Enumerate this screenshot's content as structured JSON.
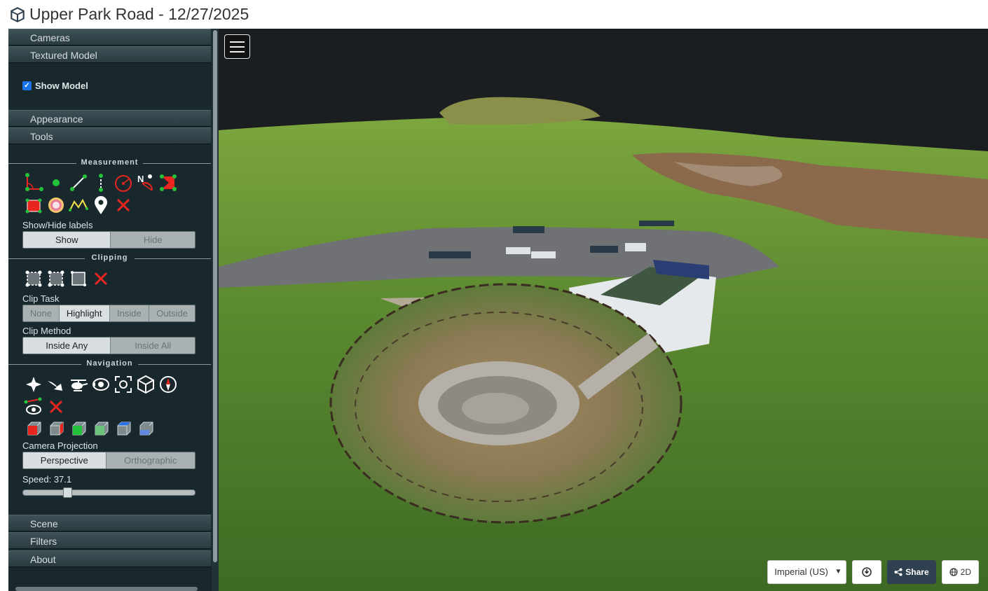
{
  "title": "Upper Park Road - 12/27/2025",
  "title_icon": "cube-icon",
  "sidebar": {
    "headers": {
      "cameras": "Cameras",
      "textured_model": "Textured Model",
      "appearance": "Appearance",
      "tools": "Tools",
      "scene": "Scene",
      "filters": "Filters",
      "about": "About"
    },
    "textured_model": {
      "show_model_label": "Show Model",
      "show_model_checked": true
    },
    "measurement": {
      "title": "Measurement",
      "tools": [
        "angle-icon",
        "point-icon",
        "distance-icon",
        "height-icon",
        "circle-icon",
        "azimuth-icon",
        "area-icon",
        "volume-icon",
        "profile-color-icon",
        "profile-line-icon",
        "annotation-icon",
        "remove-all-icon"
      ],
      "labels_title": "Show/Hide labels",
      "labels_options": [
        "Show",
        "Hide"
      ],
      "labels_selected": "Show"
    },
    "clipping": {
      "title": "Clipping",
      "tools": [
        "clip-volume-icon",
        "clip-polygon-icon",
        "clip-screen-box-icon",
        "remove-clip-icon"
      ],
      "task_title": "Clip Task",
      "task_options": [
        "None",
        "Highlight",
        "Inside",
        "Outside"
      ],
      "task_selected": "Highlight",
      "method_title": "Clip Method",
      "method_options": [
        "Inside Any",
        "Inside All"
      ],
      "method_selected": "Inside Any"
    },
    "navigation": {
      "title": "Navigation",
      "tools": [
        "earth-control-icon",
        "fly-control-icon",
        "helicopter-control-icon",
        "orbit-control-icon",
        "focus-icon",
        "navigation-cube-icon",
        "compass-icon",
        "camera-animation-icon",
        "remove-camera-icon"
      ],
      "views": [
        "left-view-icon",
        "front-view-icon",
        "top-view-icon",
        "bottom-view-icon",
        "right-view-icon",
        "back-view-icon"
      ],
      "projection_title": "Camera Projection",
      "projection_options": [
        "Perspective",
        "Orthographic"
      ],
      "projection_selected": "Perspective",
      "speed_label": "Speed: 37.1",
      "speed_fraction": 0.25
    }
  },
  "viewer": {
    "units": "Imperial (US)",
    "info_icon": "download-icon",
    "share_label": "Share",
    "share_icon": "share-icon",
    "mode_label": "2D",
    "mode_icon": "globe-icon"
  },
  "colors": {
    "sidebar_bg": "#19282c",
    "accent_red": "#e8251f",
    "accent_green": "#22c23a"
  }
}
